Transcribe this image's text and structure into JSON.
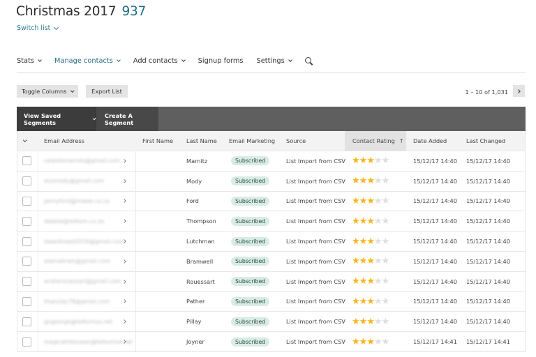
{
  "header": {
    "title": "Christmas 2017",
    "count": "937",
    "switch_list_label": "Switch list"
  },
  "nav": {
    "items": [
      {
        "label": "Stats",
        "has_dropdown": true,
        "active": false
      },
      {
        "label": "Manage contacts",
        "has_dropdown": true,
        "active": true
      },
      {
        "label": "Add contacts",
        "has_dropdown": true,
        "active": false
      },
      {
        "label": "Signup forms",
        "has_dropdown": false,
        "active": false
      },
      {
        "label": "Settings",
        "has_dropdown": true,
        "active": false
      }
    ],
    "search_icon": "search-icon"
  },
  "toolbar": {
    "toggle_columns_label": "Toggle Columns",
    "export_list_label": "Export List",
    "pager_text": "1 – 10 of 1,031",
    "next_icon": "chevron-right-icon"
  },
  "segments": {
    "view_saved_label": "View Saved Segments",
    "create_label": "Create A Segment"
  },
  "table": {
    "columns": [
      "Email Address",
      "First Name",
      "Last Name",
      "Email Marketing",
      "Source",
      "Contact Rating",
      "Date Added",
      "Last Changed"
    ],
    "sorted_column": "Contact Rating",
    "sort_direction": "ascending",
    "rating_max": 5,
    "rows": [
      {
        "email": "celestemarnitz@gmail.com",
        "first_name": "",
        "last_name": "Marnitz",
        "marketing": "Subscribed",
        "source": "List Import from CSV",
        "rating": 3,
        "date_added": "15/12/17 14:40",
        "last_changed": "15/12/17 14:40"
      },
      {
        "email": "esomody@gmail.com",
        "first_name": "",
        "last_name": "Mody",
        "marketing": "Subscribed",
        "source": "List Import from CSV",
        "rating": 3,
        "date_added": "15/12/17 14:40",
        "last_changed": "15/12/17 14:40"
      },
      {
        "email": "jennyford@mweb.co.za",
        "first_name": "",
        "last_name": "Ford",
        "marketing": "Subscribed",
        "source": "List Import from CSV",
        "rating": 3,
        "date_added": "15/12/17 14:40",
        "last_changed": "15/12/17 14:40"
      },
      {
        "email": "debbie@telkom.co.za",
        "first_name": "",
        "last_name": "Thompson",
        "marketing": "Subscribed",
        "source": "List Import from CSV",
        "rating": 3,
        "date_added": "15/12/17 14:40",
        "last_changed": "15/12/17 14:40"
      },
      {
        "email": "dawnbreed2016@gmail.com",
        "first_name": "",
        "last_name": "Lutchman",
        "marketing": "Subscribed",
        "source": "List Import from CSV",
        "rating": 3,
        "date_added": "15/12/17 14:40",
        "last_changed": "15/12/17 14:40"
      },
      {
        "email": "alainabram@gmail.com",
        "first_name": "",
        "last_name": "Bramwell",
        "marketing": "Subscribed",
        "source": "List Import from CSV",
        "rating": 3,
        "date_added": "15/12/17 14:40",
        "last_changed": "15/12/17 14:40"
      },
      {
        "email": "andrerouessart@gmail.com",
        "first_name": "",
        "last_name": "Rouessart",
        "marketing": "Subscribed",
        "source": "List Import from CSV",
        "rating": 3,
        "date_added": "15/12/17 14:40",
        "last_changed": "15/12/17 14:40"
      },
      {
        "email": "kharylay78@gmail.com",
        "first_name": "",
        "last_name": "Pather",
        "marketing": "Subscribed",
        "source": "List Import from CSV",
        "rating": 3,
        "date_added": "15/12/17 14:40",
        "last_changed": "15/12/17 14:40"
      },
      {
        "email": "gogeorge@telkomsa.net",
        "first_name": "",
        "last_name": "Pillay",
        "marketing": "Subscribed",
        "source": "List Import from CSV",
        "rating": 3,
        "date_added": "15/12/17 14:40",
        "last_changed": "15/12/17 14:40"
      },
      {
        "email": "magicwhiteswan@telkomsa.net",
        "first_name": "",
        "last_name": "Joyner",
        "marketing": "Subscribed",
        "source": "List Import from CSV",
        "rating": 3,
        "date_added": "15/12/17 14:41",
        "last_changed": "15/12/17 14:41"
      }
    ]
  }
}
